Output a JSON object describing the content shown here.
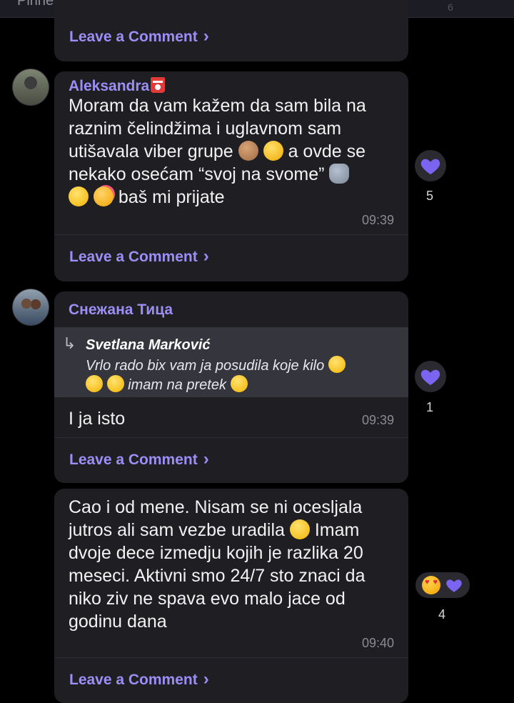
{
  "pinned_bar": {
    "text": "Pinned yesterday",
    "count": "6"
  },
  "leave_comment": "Leave a Comment",
  "posts": [
    {
      "time": "",
      "reaction_count": ""
    },
    {
      "author": "Aleksandra",
      "lines": [
        "Moram da vam kažem da sam bila na",
        "raznim čelindžima i uglavnom sam",
        "utišavala viber grupe",
        "a ovde se",
        "nekako osećam “svoj na svome”",
        "baš mi prijate"
      ],
      "time": "09:39",
      "reaction_count": "5"
    },
    {
      "author": "Снежана Тица",
      "reply_to": {
        "name": "Svetlana Marković",
        "line1": "Vrlo rado bix vam ja posudila koje kilo",
        "line2": "imam na pretek"
      },
      "text": "I ja isto",
      "time": "09:39",
      "reaction_count": "1"
    },
    {
      "lines": [
        "Cao i od mene. Nisam se ni ocesljala",
        "jutros ali sam vezbe uradila",
        "Imam",
        "dvoje dece izmedju kojih je razlika 20",
        "meseci. Aktivni smo 24/7 sto znaci da",
        "niko ziv ne spava evo malo jace od",
        "godinu dana"
      ],
      "time": "09:40",
      "reaction_count": "4"
    }
  ],
  "reaction_color": "#7b64f0",
  "accent_color": "#9b8ef5"
}
